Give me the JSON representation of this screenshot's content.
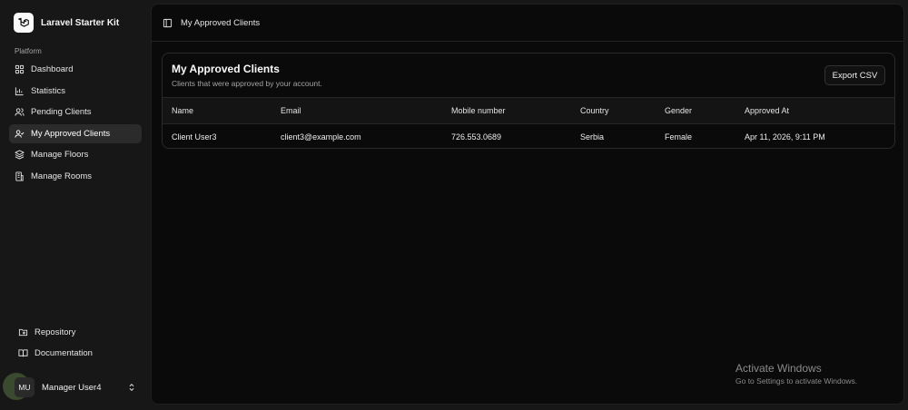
{
  "brand": {
    "name": "Laravel Starter Kit"
  },
  "sidebar": {
    "section_label": "Platform",
    "items": [
      {
        "label": "Dashboard",
        "icon": "grid-icon",
        "active": false
      },
      {
        "label": "Statistics",
        "icon": "bar-chart-icon",
        "active": false
      },
      {
        "label": "Pending Clients",
        "icon": "users-icon",
        "active": false
      },
      {
        "label": "My Approved Clients",
        "icon": "user-check-icon",
        "active": true
      },
      {
        "label": "Manage Floors",
        "icon": "layers-icon",
        "active": false
      },
      {
        "label": "Manage Rooms",
        "icon": "building-icon",
        "active": false
      }
    ],
    "footer_items": [
      {
        "label": "Repository",
        "icon": "folder-git-icon"
      },
      {
        "label": "Documentation",
        "icon": "book-open-icon"
      }
    ],
    "user": {
      "initials": "MU",
      "name": "Manager User4"
    }
  },
  "header": {
    "title": "My Approved Clients"
  },
  "card": {
    "title": "My Approved Clients",
    "subtitle": "Clients that were approved by your account.",
    "export_label": "Export CSV"
  },
  "table": {
    "columns": [
      "Name",
      "Email",
      "Mobile number",
      "Country",
      "Gender",
      "Approved At"
    ],
    "rows": [
      [
        "Client User3",
        "client3@example.com",
        "726.553.0689",
        "Serbia",
        "Female",
        "Apr 11, 2026, 9:11 PM"
      ]
    ]
  },
  "watermark": {
    "title": "Activate Windows",
    "subtitle": "Go to Settings to activate Windows."
  },
  "colors": {
    "sidebar_bg": "#171717",
    "main_bg": "#0a0a0a",
    "active_item_bg": "#2b2b2b",
    "text": "#ededed",
    "muted": "#a3a3a3"
  }
}
